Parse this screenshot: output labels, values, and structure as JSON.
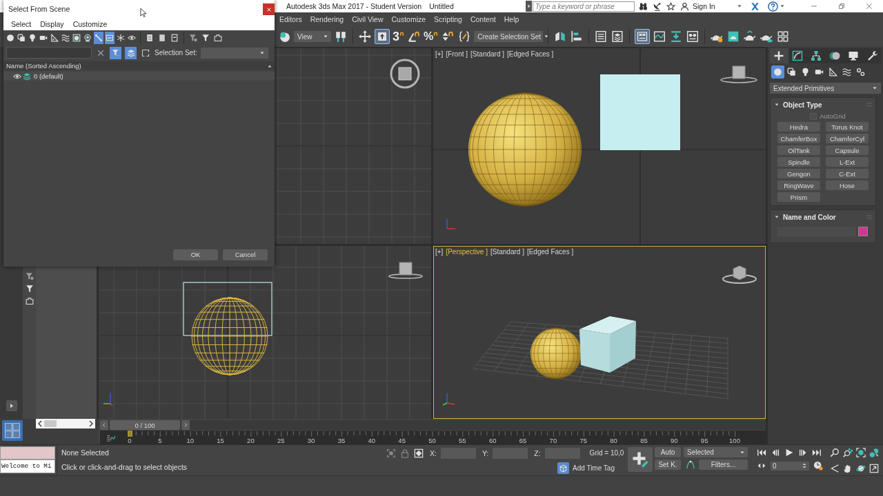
{
  "title_bar": {
    "title": "Autodesk 3ds Max 2017 - Student Version",
    "document": "Untitled",
    "search": {
      "placeholder": "Type a keyword or phrase"
    },
    "sign_in": "Sign In"
  },
  "menu_bar": [
    "Editors",
    "Rendering",
    "Civil View",
    "Customize",
    "Scripting",
    "Content",
    "Help"
  ],
  "main_toolbar": {
    "reference_dropdown": "View",
    "snap_glyph": "3",
    "percent_glyph": "%",
    "selection_set_dropdown": "Create Selection Set",
    "manipulate_on": true,
    "ribbon_on": true
  },
  "viewports": [
    {
      "kind": "top",
      "active": false
    },
    {
      "kind": "front",
      "active": false,
      "label": [
        "[+]",
        "[Front ]",
        "[Standard ]",
        "[Edged Faces ]"
      ]
    },
    {
      "kind": "left",
      "active": false
    },
    {
      "kind": "perspective",
      "active": true,
      "label": [
        "[+]",
        "[Perspective ]",
        "[Standard ]",
        "[Edged Faces ]"
      ]
    }
  ],
  "command_panel": {
    "tabs": [
      {
        "selected": true
      },
      {
        "selected": false
      },
      {
        "selected": false
      },
      {
        "selected": false
      },
      {
        "selected": false
      },
      {
        "selected": false
      }
    ],
    "categories": [
      {
        "selected": true
      },
      {
        "selected": false
      },
      {
        "selected": false
      },
      {
        "selected": false
      },
      {
        "selected": false
      },
      {
        "selected": false
      },
      {
        "selected": false
      }
    ],
    "dropdown": "Extended Primitives",
    "object_type": {
      "title": "Object Type",
      "expanded": true,
      "autogrid": {
        "label": "AutoGrid",
        "checked": false,
        "disabled": true
      },
      "buttons": [
        "Hedra",
        "Torus Knot",
        "ChamferBox",
        "ChamferCyl",
        "OilTank",
        "Capsule",
        "Spindle",
        "L-Ext",
        "Gengon",
        "C-Ext",
        "RingWave",
        "Hose",
        "Prism"
      ]
    },
    "name_and_color": {
      "title": "Name and Color",
      "expanded": true,
      "color": "#d4358f"
    }
  },
  "timeline": {
    "time_slider": {
      "label": "0 / 100",
      "level": 0
    },
    "ruler": [
      "0",
      "5",
      "10",
      "15",
      "20",
      "25",
      "30",
      "35",
      "40",
      "45",
      "50",
      "55",
      "60",
      "65",
      "70",
      "75",
      "80",
      "85",
      "90",
      "95",
      "100"
    ]
  },
  "status_bar": {
    "maxscript_output": "Welcome to Mi",
    "selection": "None Selected",
    "prompt": "Click or click-and-drag to select objects",
    "coordinates": [
      "X:",
      "Y:",
      "Z:"
    ],
    "grid": "Grid = 10,0",
    "time_tag": "Add Time Tag",
    "auto_key": {
      "label": "Auto",
      "on": false
    },
    "set_key": "Set K.",
    "key_filter": "Selected",
    "filters": "Filters...",
    "frame": "0"
  },
  "dialog": {
    "title": "Select From Scene",
    "menu": [
      "Select",
      "Display",
      "Customize"
    ],
    "type_filters": [
      {
        "on": false
      },
      {
        "on": false
      },
      {
        "on": false
      },
      {
        "on": false
      },
      {
        "on": false
      },
      {
        "on": false
      },
      {
        "on": false
      },
      {
        "on": false
      },
      {
        "on": true
      },
      {
        "on": true
      },
      {
        "on": false
      },
      {
        "on": false
      }
    ],
    "filter_on": true,
    "layers_on": true,
    "selection_set_label": "Selection Set:",
    "column": "Name (Sorted Ascending)",
    "rows": [
      {
        "name": "0 (default)",
        "selected": false
      }
    ],
    "buttons": [
      "OK",
      "Cancel"
    ]
  }
}
